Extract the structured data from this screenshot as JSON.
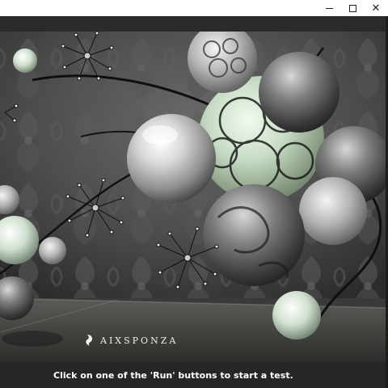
{
  "window": {
    "title": "",
    "controls": {
      "minimize_icon": "minimize-icon",
      "maximize_icon": "maximize-icon",
      "close_icon": "close-icon",
      "close_glyph": "✕"
    }
  },
  "scene": {
    "description_icon": "benchmark-render-image"
  },
  "logo": {
    "text": "AIXSPONZA"
  },
  "status": {
    "message": "Click on one of the 'Run' buttons to start a test."
  },
  "colors": {
    "titlebar": "#ffffff",
    "window_bg": "#262626",
    "status_text": "#ffffff"
  }
}
